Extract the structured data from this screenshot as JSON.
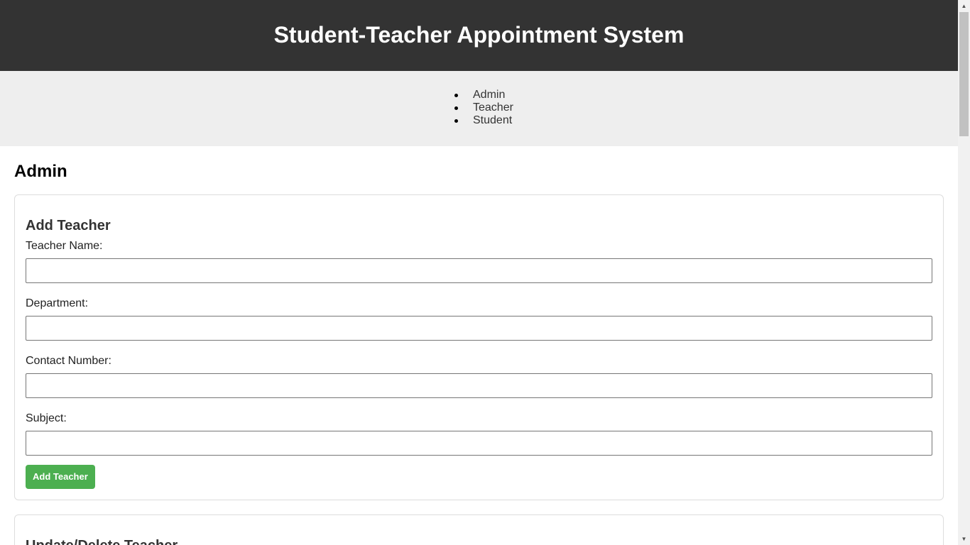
{
  "header": {
    "title": "Student-Teacher Appointment System"
  },
  "nav": {
    "items": [
      "Admin",
      "Teacher",
      "Student"
    ]
  },
  "main": {
    "section_title": "Admin",
    "add_teacher": {
      "title": "Add Teacher",
      "fields": [
        {
          "label": "Teacher Name:",
          "value": ""
        },
        {
          "label": "Department:",
          "value": ""
        },
        {
          "label": "Contact Number:",
          "value": ""
        },
        {
          "label": "Subject:",
          "value": ""
        }
      ],
      "submit_label": "Add Teacher"
    },
    "update_teacher": {
      "title": "Update/Delete Teacher"
    }
  },
  "colors": {
    "header_bg": "#333333",
    "nav_bg": "#eeeeee",
    "button_bg": "#4caf50"
  },
  "scrollbar": {
    "up_icon": "arrow-up-icon",
    "down_icon": "arrow-down-icon"
  }
}
